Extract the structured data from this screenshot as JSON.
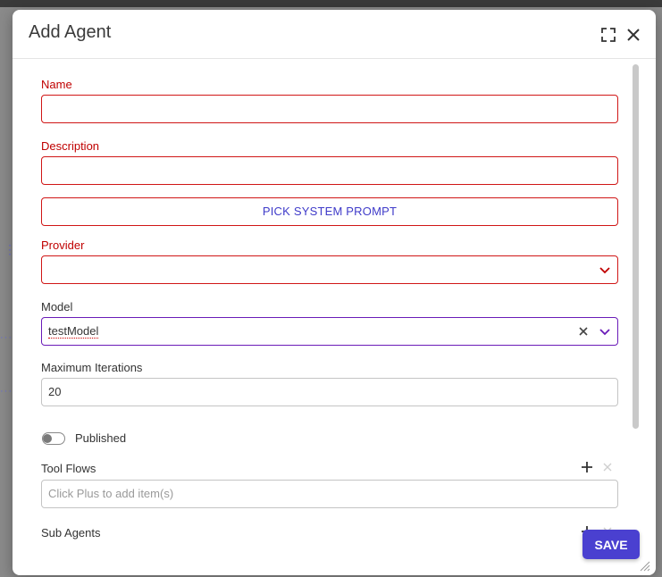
{
  "dialog": {
    "title": "Add Agent"
  },
  "form": {
    "name": {
      "label": "Name",
      "value": ""
    },
    "description": {
      "label": "Description",
      "value": ""
    },
    "pick_prompt_label": "PICK SYSTEM PROMPT",
    "provider": {
      "label": "Provider",
      "value": ""
    },
    "model": {
      "label": "Model",
      "value": "testModel"
    },
    "max_iterations": {
      "label": "Maximum Iterations",
      "value": "20"
    },
    "published": {
      "label": "Published",
      "checked": false
    },
    "tool_flows": {
      "label": "Tool Flows",
      "placeholder": "Click Plus to add item(s)"
    },
    "sub_agents": {
      "label": "Sub Agents"
    }
  },
  "footer": {
    "save_label": "SAVE"
  },
  "colors": {
    "error": "#d01616",
    "accent": "#4a40d0",
    "focus": "#6a1bb8"
  }
}
